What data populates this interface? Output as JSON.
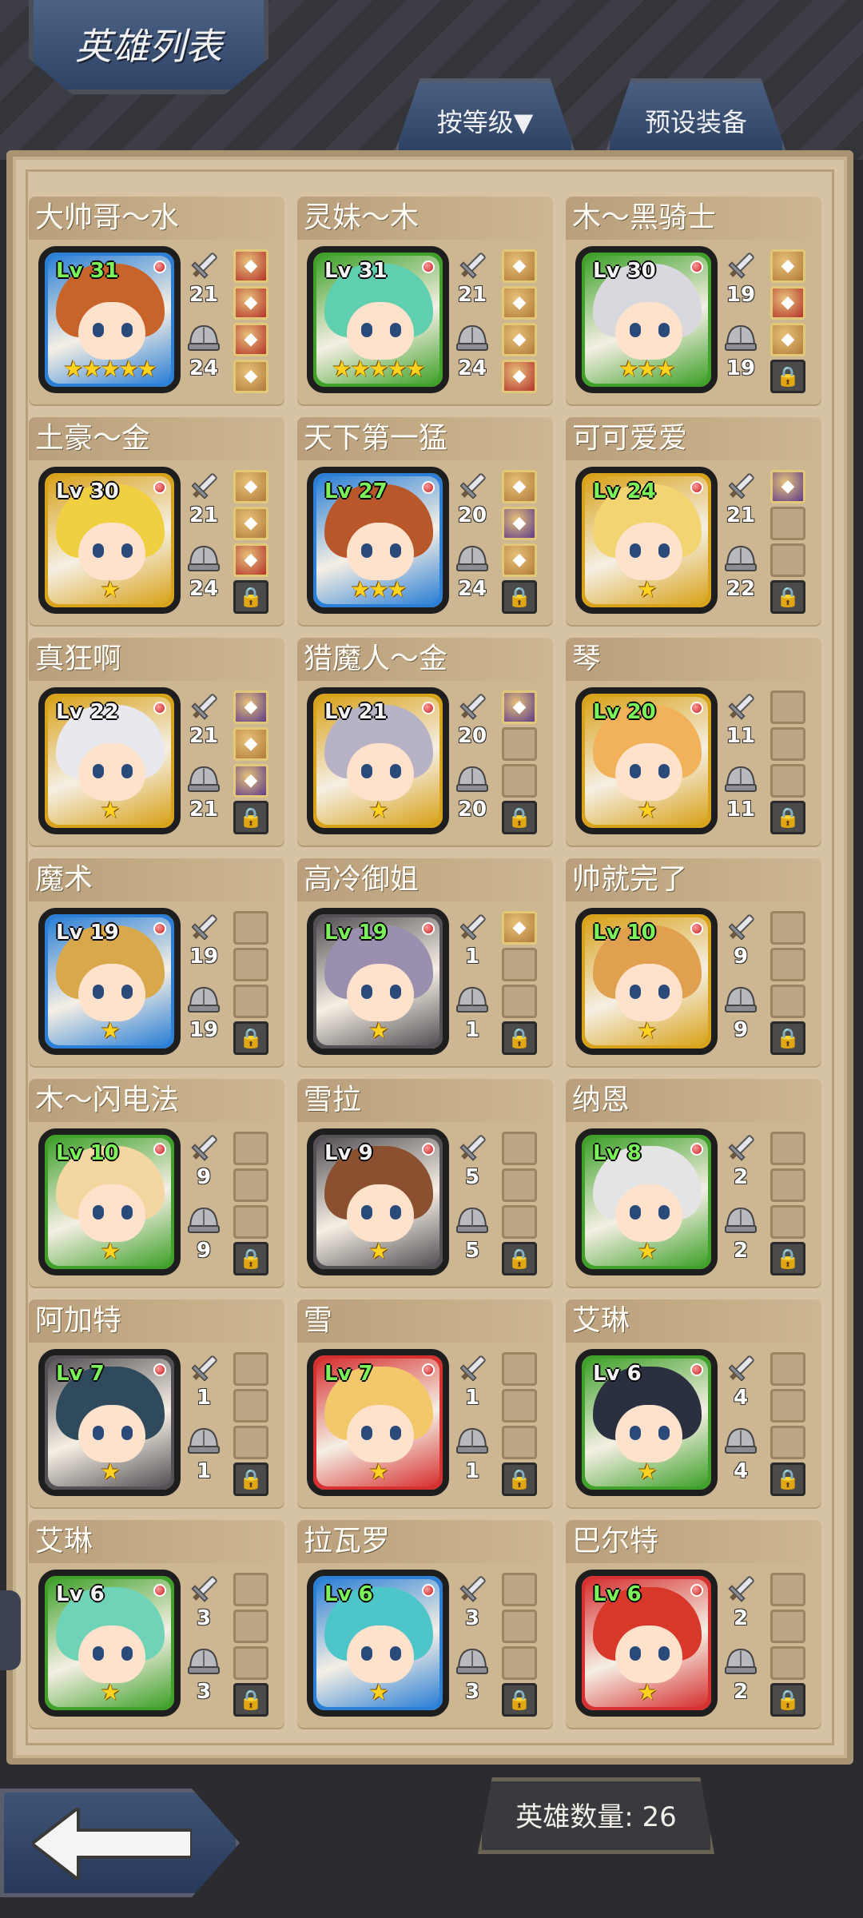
{
  "header": {
    "title": "英雄列表",
    "sort_button": "按等级▼",
    "preset_button": "预设装备"
  },
  "footer": {
    "hero_count_label": "英雄数量: 26"
  },
  "heroes": [
    {
      "name": "大帅哥～水",
      "level": "Lv 31",
      "level_color": "green",
      "frame": "#2b7fd6",
      "hair": "#c8642a",
      "stars": "★★★★★",
      "atk": "21",
      "def": "24",
      "slots": [
        "filled-red",
        "filled-red",
        "filled-red",
        "filled"
      ]
    },
    {
      "name": "灵妹～木",
      "level": "Lv 31",
      "level_color": "white",
      "frame": "#3fa12a",
      "hair": "#5fcfb0",
      "stars": "★★★★★",
      "atk": "21",
      "def": "24",
      "slots": [
        "filled",
        "filled",
        "filled",
        "filled-red"
      ]
    },
    {
      "name": "木～黑骑士",
      "level": "Lv 30",
      "level_color": "white",
      "frame": "#3fa12a",
      "hair": "#d8d8de",
      "stars": "★★★",
      "atk": "19",
      "def": "19",
      "slots": [
        "filled",
        "filled-red",
        "filled",
        "lock"
      ]
    },
    {
      "name": "土豪～金",
      "level": "Lv 30",
      "level_color": "white",
      "frame": "#d8a21a",
      "hair": "#f0cf40",
      "stars": "★",
      "atk": "21",
      "def": "24",
      "slots": [
        "filled",
        "filled",
        "filled-red",
        "lock"
      ]
    },
    {
      "name": "天下第一猛",
      "level": "Lv 27",
      "level_color": "green",
      "frame": "#2b7fd6",
      "hair": "#b8582a",
      "stars": "★★★",
      "atk": "20",
      "def": "24",
      "slots": [
        "filled",
        "filled-purple",
        "filled",
        "lock"
      ]
    },
    {
      "name": "可可爱爱",
      "level": "Lv 24",
      "level_color": "green",
      "frame": "#d8a21a",
      "hair": "#f2d470",
      "stars": "★",
      "atk": "21",
      "def": "22",
      "slots": [
        "filled-purple",
        "empty",
        "empty",
        "lock"
      ]
    },
    {
      "name": "真狂啊",
      "level": "Lv 22",
      "level_color": "white",
      "frame": "#d8a21a",
      "hair": "#e8e8ee",
      "stars": "★",
      "atk": "21",
      "def": "21",
      "slots": [
        "filled-purple",
        "filled",
        "filled-purple",
        "lock"
      ]
    },
    {
      "name": "猎魔人～金",
      "level": "Lv 21",
      "level_color": "white",
      "frame": "#d8a21a",
      "hair": "#b7b2c6",
      "stars": "★",
      "atk": "20",
      "def": "20",
      "slots": [
        "filled-purple",
        "empty",
        "empty",
        "lock"
      ]
    },
    {
      "name": "琴",
      "level": "Lv 20",
      "level_color": "green",
      "frame": "#d8a21a",
      "hair": "#f2b25a",
      "stars": "★",
      "atk": "11",
      "def": "11",
      "slots": [
        "empty",
        "empty",
        "empty",
        "lock"
      ]
    },
    {
      "name": "魔术",
      "level": "Lv 19",
      "level_color": "white",
      "frame": "#2b7fd6",
      "hair": "#d8a84a",
      "stars": "★",
      "atk": "19",
      "def": "19",
      "slots": [
        "empty",
        "empty",
        "empty",
        "lock"
      ]
    },
    {
      "name": "高冷御姐",
      "level": "Lv 19",
      "level_color": "green",
      "frame": "#555055",
      "hair": "#9a8fae",
      "stars": "★",
      "atk": "1",
      "def": "1",
      "slots": [
        "filled",
        "empty",
        "empty",
        "lock"
      ]
    },
    {
      "name": "帅就完了",
      "level": "Lv 10",
      "level_color": "green",
      "frame": "#d8a21a",
      "hair": "#e0a050",
      "stars": "★",
      "atk": "9",
      "def": "9",
      "slots": [
        "empty",
        "empty",
        "empty",
        "lock"
      ]
    },
    {
      "name": "木～闪电法",
      "level": "Lv 10",
      "level_color": "green",
      "frame": "#3fa12a",
      "hair": "#f3d6a0",
      "stars": "★",
      "atk": "9",
      "def": "9",
      "slots": [
        "empty",
        "empty",
        "empty",
        "lock"
      ]
    },
    {
      "name": "雪拉",
      "level": "Lv 9",
      "level_color": "white",
      "frame": "#555055",
      "hair": "#8a5030",
      "stars": "★",
      "atk": "5",
      "def": "5",
      "slots": [
        "empty",
        "empty",
        "empty",
        "lock"
      ]
    },
    {
      "name": "纳恩",
      "level": "Lv 8",
      "level_color": "green",
      "frame": "#3fa12a",
      "hair": "#e4e4e4",
      "stars": "★",
      "atk": "2",
      "def": "2",
      "slots": [
        "empty",
        "empty",
        "empty",
        "lock"
      ]
    },
    {
      "name": "阿加特",
      "level": "Lv 7",
      "level_color": "green",
      "frame": "#555055",
      "hair": "#2f4a5c",
      "stars": "★",
      "atk": "1",
      "def": "1",
      "slots": [
        "empty",
        "empty",
        "empty",
        "lock"
      ]
    },
    {
      "name": "雪",
      "level": "Lv 7",
      "level_color": "green",
      "frame": "#d63030",
      "hair": "#f2c86a",
      "stars": "★",
      "atk": "1",
      "def": "1",
      "slots": [
        "empty",
        "empty",
        "empty",
        "lock"
      ]
    },
    {
      "name": "艾琳",
      "level": "Lv 6",
      "level_color": "white",
      "frame": "#3fa12a",
      "hair": "#2a3040",
      "stars": "★",
      "atk": "4",
      "def": "4",
      "slots": [
        "empty",
        "empty",
        "empty",
        "lock"
      ]
    },
    {
      "name": "艾琳",
      "level": "Lv 6",
      "level_color": "white",
      "frame": "#3fa12a",
      "hair": "#6fd3b8",
      "stars": "★",
      "atk": "3",
      "def": "3",
      "slots": [
        "empty",
        "empty",
        "empty",
        "lock"
      ]
    },
    {
      "name": "拉瓦罗",
      "level": "Lv 6",
      "level_color": "green",
      "frame": "#2b7fd6",
      "hair": "#4ec5c8",
      "stars": "★",
      "atk": "3",
      "def": "3",
      "slots": [
        "empty",
        "empty",
        "empty",
        "lock"
      ]
    },
    {
      "name": "巴尔特",
      "level": "Lv 6",
      "level_color": "green",
      "frame": "#d63030",
      "hair": "#d8382a",
      "stars": "★",
      "atk": "2",
      "def": "2",
      "slots": [
        "empty",
        "empty",
        "empty",
        "lock"
      ]
    }
  ],
  "colors": {
    "panel": "#d6c3a3",
    "card": "#cdb692",
    "header_blue": "#3a5278",
    "level_green": "#7cf25a",
    "star_gold": "#ffd21f"
  },
  "icons": {
    "attack": "sword-icon",
    "defense": "helmet-icon",
    "locked_slot": "lock-icon",
    "back": "back-arrow-icon"
  }
}
